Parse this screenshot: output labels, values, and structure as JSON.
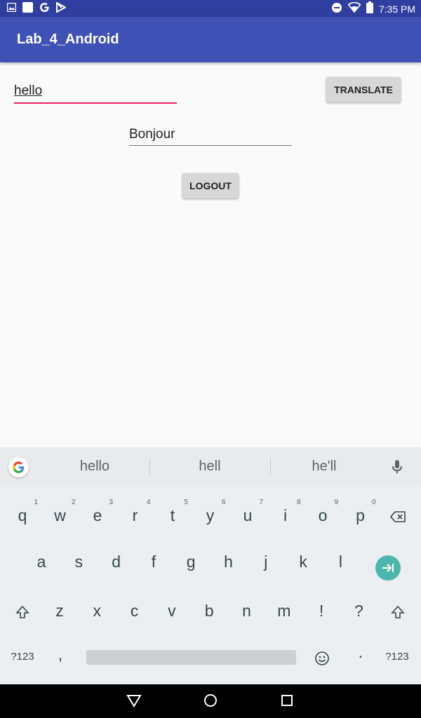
{
  "status_bar": {
    "time": "7:35 PM",
    "left_icons": [
      "image-icon",
      "square-notification-icon",
      "google-g-icon",
      "play-store-icon"
    ],
    "right_icons": [
      "do-not-disturb-icon",
      "wifi-icon",
      "battery-icon"
    ]
  },
  "app_bar": {
    "title": "Lab_4_Android"
  },
  "main": {
    "input_value": "hello",
    "output_value": "Bonjour",
    "translate_label": "TRANSLATE",
    "logout_label": "LOGOUT"
  },
  "keyboard": {
    "suggestions": [
      "hello",
      "hell",
      "he'll"
    ],
    "row1": [
      {
        "k": "q",
        "h": "1"
      },
      {
        "k": "w",
        "h": "2"
      },
      {
        "k": "e",
        "h": "3"
      },
      {
        "k": "r",
        "h": "4"
      },
      {
        "k": "t",
        "h": "5"
      },
      {
        "k": "y",
        "h": "6"
      },
      {
        "k": "u",
        "h": "7"
      },
      {
        "k": "i",
        "h": "8"
      },
      {
        "k": "o",
        "h": "9"
      },
      {
        "k": "p",
        "h": "0"
      }
    ],
    "row2": [
      "a",
      "s",
      "d",
      "f",
      "g",
      "h",
      "j",
      "k",
      "l"
    ],
    "row3": [
      "z",
      "x",
      "c",
      "v",
      "b",
      "n",
      "m",
      "!",
      "?"
    ],
    "row4": {
      "symbols_left": "?123",
      "comma": ",",
      "period": "·",
      "symbols_right": "?123"
    }
  },
  "colors": {
    "status_bar": "#303f9f",
    "app_bar": "#3f51b5",
    "accent": "#e91e63",
    "enter_key": "#4db6ac"
  }
}
